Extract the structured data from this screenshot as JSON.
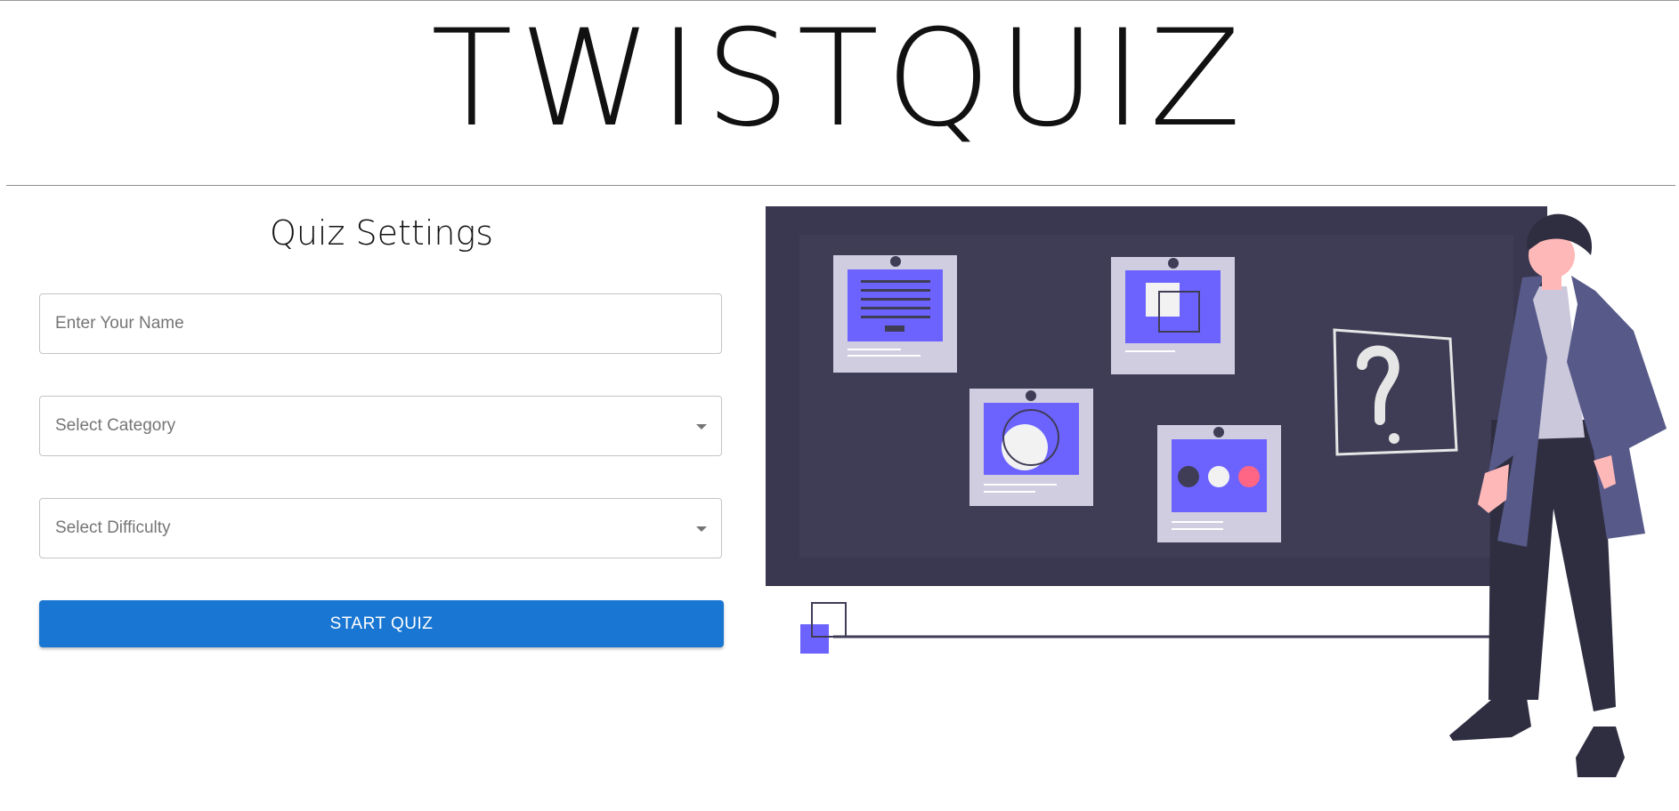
{
  "app": {
    "title": "TWISTQUIZ"
  },
  "settings": {
    "heading": "Quiz Settings",
    "name_placeholder": "Enter Your Name",
    "category_placeholder": "Select Category",
    "difficulty_placeholder": "Select Difficulty",
    "start_label": "START QUIZ"
  },
  "colors": {
    "primary_button": "#1976d2",
    "board_background": "#3f3d56",
    "accent": "#6c63ff",
    "coat": "#575a89",
    "pink_dot": "#ff6584"
  },
  "illustration": {
    "board_symbol": "?"
  }
}
